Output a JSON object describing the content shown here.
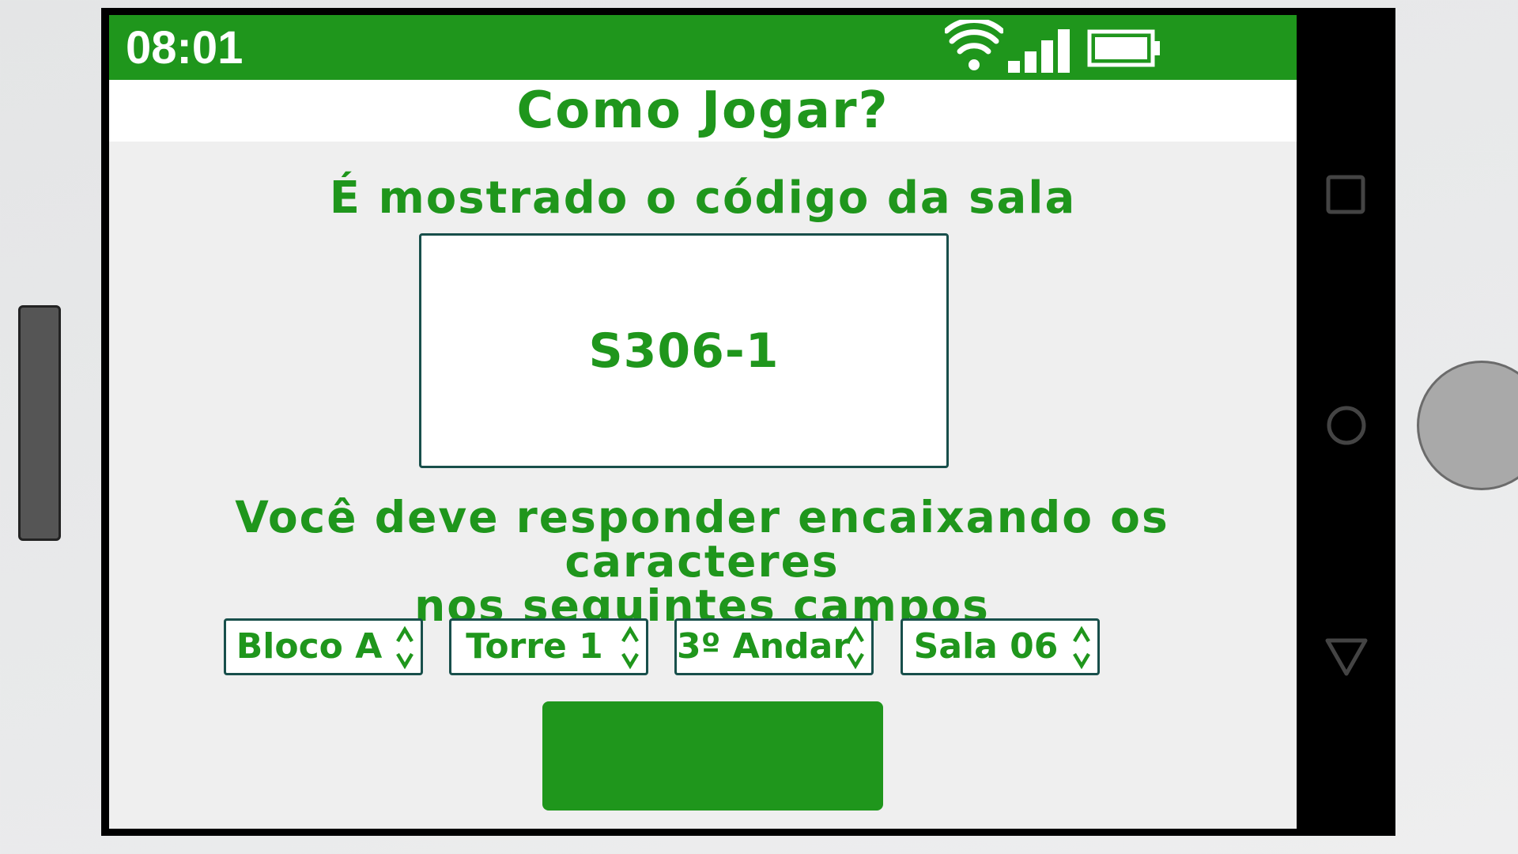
{
  "status_bar": {
    "time": "08:01",
    "icons": [
      "wifi-icon",
      "signal-icon",
      "battery-icon"
    ],
    "color": "#1f961c"
  },
  "header": {
    "title": "Como Jogar?"
  },
  "main": {
    "subtitle": "É mostrado o código da sala",
    "room_code": "S306-1",
    "instruction_line1": "Você deve responder encaixando os caracteres",
    "instruction_line2": "nos seguintes campos",
    "fields": [
      {
        "label": "Bloco A"
      },
      {
        "label": "Torre 1"
      },
      {
        "label": "3º Andar"
      },
      {
        "label": "Sala 06"
      }
    ],
    "submit_color": "#1f961c"
  },
  "nav_bar": {
    "icons": [
      "recent-apps-icon",
      "home-circle-icon",
      "back-triangle-icon"
    ]
  },
  "colors": {
    "accent": "#1f961c",
    "border": "#184f4b",
    "background": "#efefef"
  }
}
